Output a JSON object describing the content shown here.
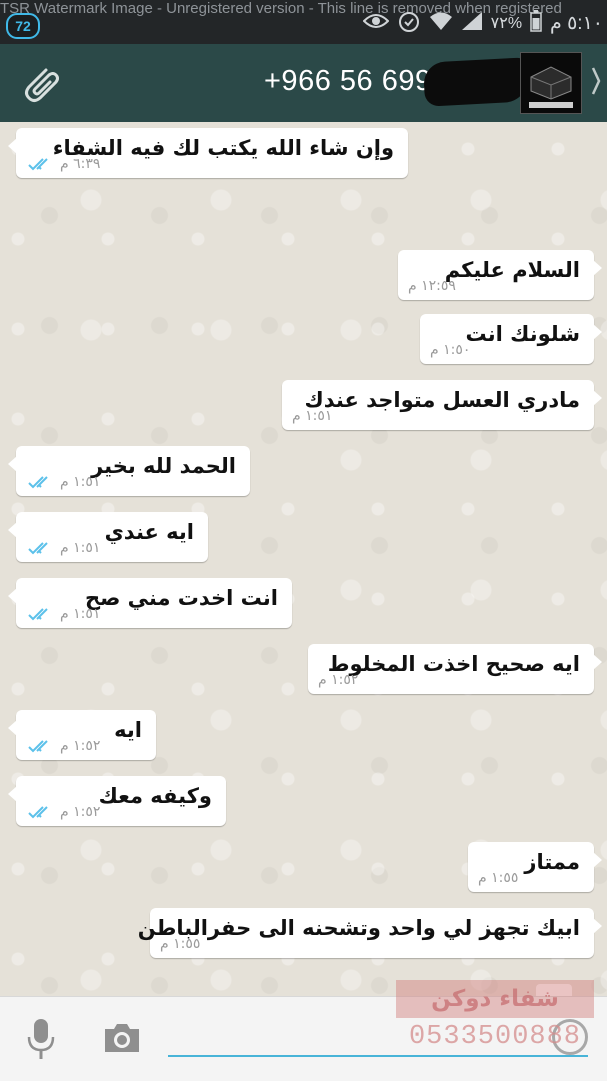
{
  "status_bar": {
    "watermark": "TSR Watermark Image - Unregistered version - This line is removed when registered",
    "notification_count": "72",
    "battery": "٧٢%",
    "clock": "٥:١٠ م"
  },
  "header": {
    "contact_title": "+966 56 699"
  },
  "messages": [
    {
      "direction": "sent",
      "text": "وإن شاء الله يكتب لك فيه الشفاء",
      "time": "٦:٣٩ م"
    },
    {
      "direction": "received",
      "text": "السلام عليكم",
      "time": "١٢:٥٩ م"
    },
    {
      "direction": "received",
      "text": "شلونك انت",
      "time": "١:٥٠ م"
    },
    {
      "direction": "received",
      "text": "مادري العسل متواجد عندك",
      "time": "١:٥١ م"
    },
    {
      "direction": "sent",
      "text": "الحمد لله بخير",
      "time": "١:٥١ م"
    },
    {
      "direction": "sent",
      "text": "ايه عندي",
      "time": "١:٥١ م"
    },
    {
      "direction": "sent",
      "text": "انت اخدت مني صح",
      "time": "١:٥١ م"
    },
    {
      "direction": "received",
      "text": "ايه صحيح اخذت المخلوط",
      "time": "١:٥٢ م"
    },
    {
      "direction": "sent",
      "text": "ايه",
      "time": "١:٥٢ م"
    },
    {
      "direction": "sent",
      "text": "وكيفه معك",
      "time": "١:٥٢ م"
    },
    {
      "direction": "received",
      "text": "ممتاز",
      "time": "١:٥٥ م"
    },
    {
      "direction": "received",
      "text": "ابيك تجهز لي واحد وتشحنه الى حفرالباطن",
      "time": "١:٥٥ م"
    }
  ],
  "stamp": {
    "name": "شفاء دوكن",
    "phone": "0533500888"
  },
  "colors": {
    "header_bg": "#2b4948",
    "status_bg": "#232628",
    "read_ticks": "#5cc1ea",
    "input_underline": "#48b4d8"
  }
}
